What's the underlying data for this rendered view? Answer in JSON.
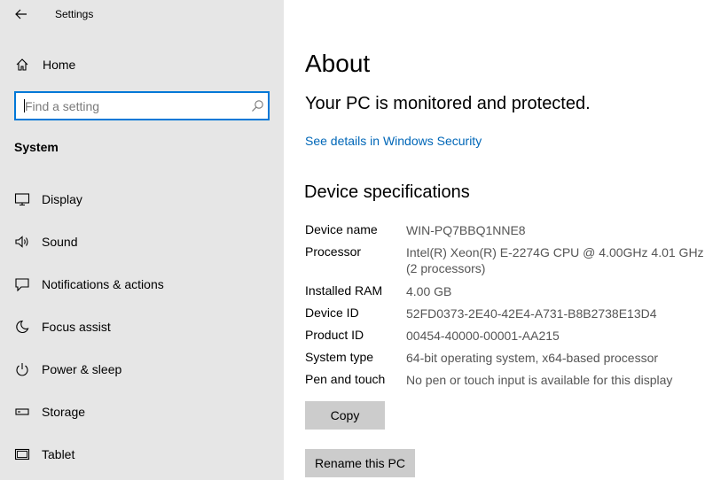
{
  "window": {
    "title": "Settings"
  },
  "sidebar": {
    "home_label": "Home",
    "search": {
      "placeholder": "Find a setting",
      "value": ""
    },
    "section_heading": "System",
    "items": [
      {
        "label": "Display",
        "icon": "display-icon"
      },
      {
        "label": "Sound",
        "icon": "speaker-icon"
      },
      {
        "label": "Notifications & actions",
        "icon": "notifications-icon"
      },
      {
        "label": "Focus assist",
        "icon": "moon-icon"
      },
      {
        "label": "Power & sleep",
        "icon": "power-icon"
      },
      {
        "label": "Storage",
        "icon": "storage-icon"
      },
      {
        "label": "Tablet",
        "icon": "tablet-icon"
      }
    ]
  },
  "main": {
    "title": "About",
    "security_status": "Your PC is monitored and protected.",
    "security_link": "See details in Windows Security",
    "specs_heading": "Device specifications",
    "specs": [
      {
        "key": "Device name",
        "value": "WIN-PQ7BBQ1NNE8"
      },
      {
        "key": "Processor",
        "value": "Intel(R) Xeon(R) E-2274G CPU @ 4.00GHz   4.01 GHz",
        "value2": "(2 processors)"
      },
      {
        "key": "Installed RAM",
        "value": "4.00 GB"
      },
      {
        "key": "Device ID",
        "value": "52FD0373-2E40-42E4-A731-B8B2738E13D4"
      },
      {
        "key": "Product ID",
        "value": "00454-40000-00001-AA215"
      },
      {
        "key": "System type",
        "value": "64-bit operating system, x64-based processor"
      },
      {
        "key": "Pen and touch",
        "value": "No pen or touch input is available for this display"
      }
    ],
    "copy_button": "Copy",
    "rename_button": "Rename this PC"
  },
  "colors": {
    "accent": "#0078d7",
    "link": "#0067b8",
    "sidebar_bg": "#e6e6e6",
    "button_bg": "#cccccc"
  }
}
